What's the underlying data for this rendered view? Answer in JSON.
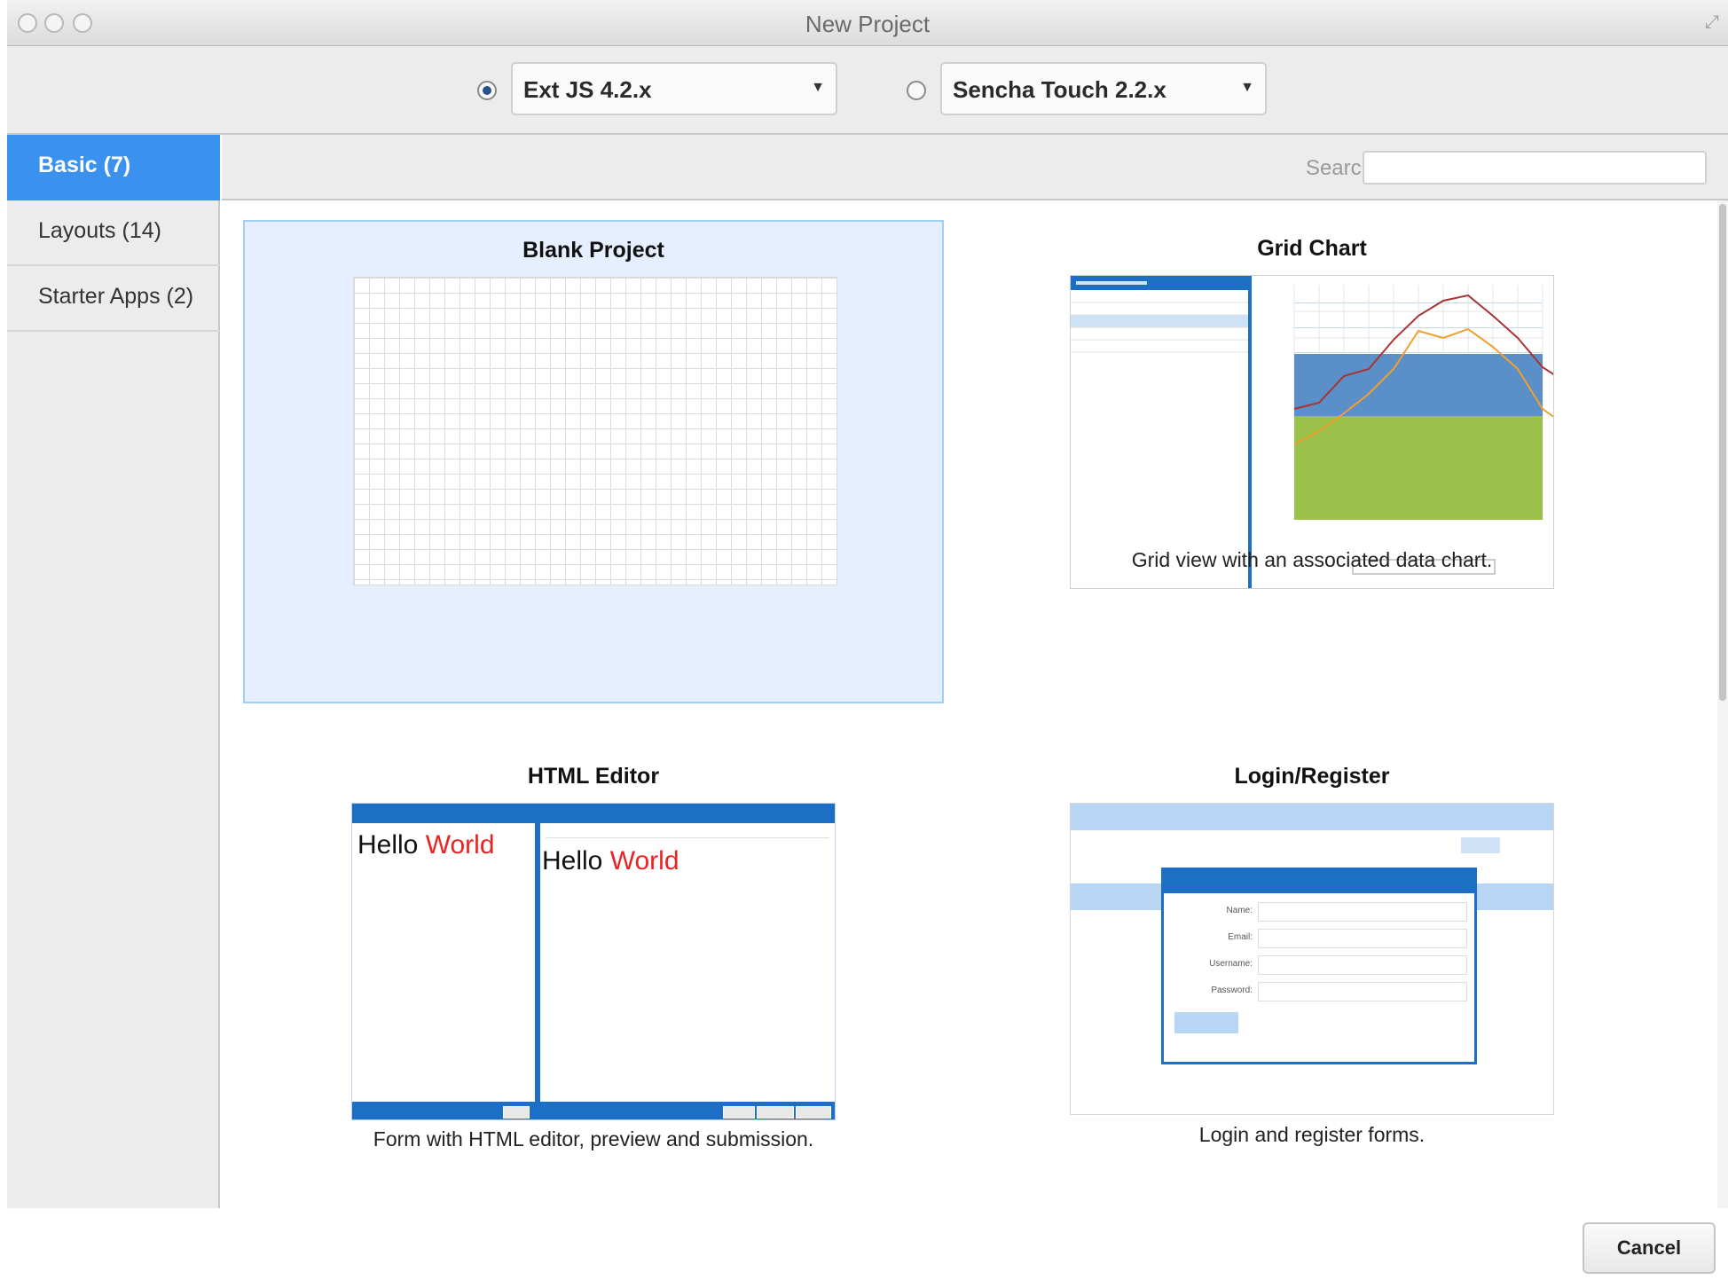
{
  "window": {
    "title": "New Project"
  },
  "frameworks": [
    {
      "label": "Ext JS 4.2.x",
      "selected": true
    },
    {
      "label": "Sencha Touch 2.2.x",
      "selected": false
    }
  ],
  "sidebar": {
    "items": [
      {
        "label": "Basic (7)",
        "active": true
      },
      {
        "label": "Layouts (14)",
        "active": false
      },
      {
        "label": "Starter Apps (2)",
        "active": false
      }
    ]
  },
  "search": {
    "label": "Search",
    "value": ""
  },
  "templates": [
    {
      "title": "Blank Project",
      "description": "",
      "selected": true
    },
    {
      "title": "Grid Chart",
      "description": "Grid view with an associated data chart.",
      "selected": false
    },
    {
      "title": "HTML Editor",
      "description": "Form with HTML editor, preview and submission.",
      "selected": false
    },
    {
      "title": "Login/Register",
      "description": "Login and register forms.",
      "selected": false
    }
  ],
  "html_editor_preview": {
    "hello": "Hello",
    "world": "World"
  },
  "login_preview": {
    "fields": [
      "Name:",
      "Email:",
      "Username:",
      "Password:"
    ]
  },
  "footer": {
    "cancel_label": "Cancel"
  },
  "colors": {
    "accent": "#3b92ee",
    "selected_card_bg": "#e6efff",
    "ext_blue": "#1c6fc4"
  }
}
